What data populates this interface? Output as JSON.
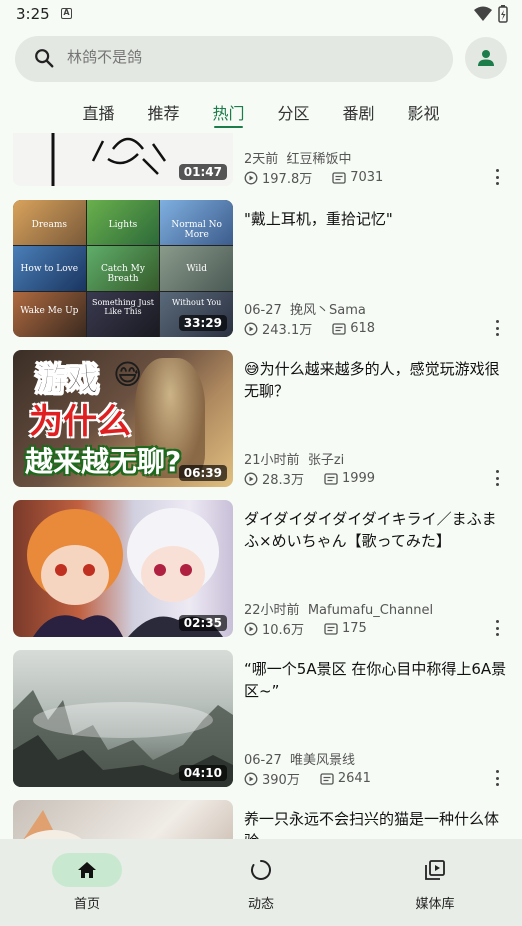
{
  "status": {
    "time": "3:25",
    "notif_letter": "A"
  },
  "search": {
    "placeholder": "林鸽不是鸽"
  },
  "tabs": [
    {
      "label": "直播",
      "active": false
    },
    {
      "label": "推荐",
      "active": false
    },
    {
      "label": "热门",
      "active": true
    },
    {
      "label": "分区",
      "active": false
    },
    {
      "label": "番剧",
      "active": false
    },
    {
      "label": "影视",
      "active": false
    }
  ],
  "items": [
    {
      "title": "",
      "time": "2天前",
      "author": "红豆稀饭中",
      "views": "197.8万",
      "danmaku": "7031",
      "duration": "01:47"
    },
    {
      "title": "\"戴上耳机，重拾记忆\"",
      "time": "06-27",
      "author": "挽风丶Sama",
      "views": "243.1万",
      "danmaku": "618",
      "duration": "33:29"
    },
    {
      "title": "😅为什么越来越多的人，感觉玩游戏很无聊？",
      "time": "21小时前",
      "author": "张子zi",
      "views": "28.3万",
      "danmaku": "1999",
      "duration": "06:39"
    },
    {
      "title": "ダイダイダイダイダイキライ／まふまふ×めいちゃん【歌ってみた】",
      "time": "22小时前",
      "author": "Mafumafu_Channel",
      "views": "10.6万",
      "danmaku": "175",
      "duration": "02:35"
    },
    {
      "title": "“哪一个5A景区 在你心目中称得上6A景区~”",
      "time": "06-27",
      "author": "唯美风景线",
      "views": "390万",
      "danmaku": "2641",
      "duration": "04:10"
    },
    {
      "title": "养一只永远不会扫兴的猫是一种什么体验...",
      "time": "",
      "author": "",
      "views": "",
      "danmaku": "",
      "duration": ""
    }
  ],
  "thumb_text": {
    "music_tiles": [
      "Dreams",
      "Lights",
      "Normal No More",
      "How to Love",
      "Catch My Breath",
      "Wild",
      "Wake Me Up",
      "Something Just Like This",
      "Without You"
    ],
    "game_line1": "游戏",
    "game_line2": "为什么",
    "game_line3": "越来越无聊?"
  },
  "nav": [
    {
      "label": "首页",
      "icon": "home-icon",
      "active": true
    },
    {
      "label": "动态",
      "icon": "dynamic-icon",
      "active": false
    },
    {
      "label": "媒体库",
      "icon": "library-icon",
      "active": false
    }
  ],
  "colors": {
    "accent": "#1c7c4a",
    "background": "#f6fbf5",
    "nav_pill": "#c8e9cf"
  }
}
